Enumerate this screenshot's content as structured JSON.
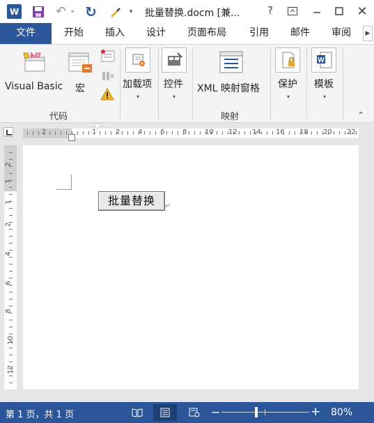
{
  "titlebar": {
    "app_icon": "word-icon",
    "app_icon_letter": "W",
    "window_title": "批量替换.docm [兼...",
    "help": "?",
    "quick_access": [
      "save-icon",
      "undo-icon",
      "redo-icon",
      "brush-icon"
    ]
  },
  "tabs": {
    "file": "文件",
    "home": "开始",
    "insert": "插入",
    "design": "设计",
    "layout": "页面布局",
    "references": "引用",
    "mailings": "邮件",
    "review": "审阅"
  },
  "ribbon": {
    "code_group": {
      "label": "代码",
      "visual_basic": "Visual Basic",
      "macros": "宏"
    },
    "addins": "加载项",
    "controls": "控件",
    "mapping_group": {
      "label": "映射",
      "xml_mapping_pane": "XML 映射窗格"
    },
    "protect": "保护",
    "templates": "模板"
  },
  "ruler": {
    "h_numbers": [
      "2",
      "1",
      "2",
      "4",
      "6",
      "8",
      "10",
      "12",
      "14",
      "16",
      "18",
      "20",
      "22"
    ],
    "v_numbers": [
      "2",
      "1",
      "1",
      "2",
      "4",
      "6",
      "8",
      "10",
      "12"
    ]
  },
  "document": {
    "button_label": "批量替换"
  },
  "statusbar": {
    "page_info": "第 1 页，共 1 页",
    "zoom": "80%",
    "zoom_fraction": 0.4
  },
  "colors": {
    "accent": "#2b579a",
    "ribbon_bg": "#f4f4f4",
    "workspace": "#e6e6e6"
  }
}
